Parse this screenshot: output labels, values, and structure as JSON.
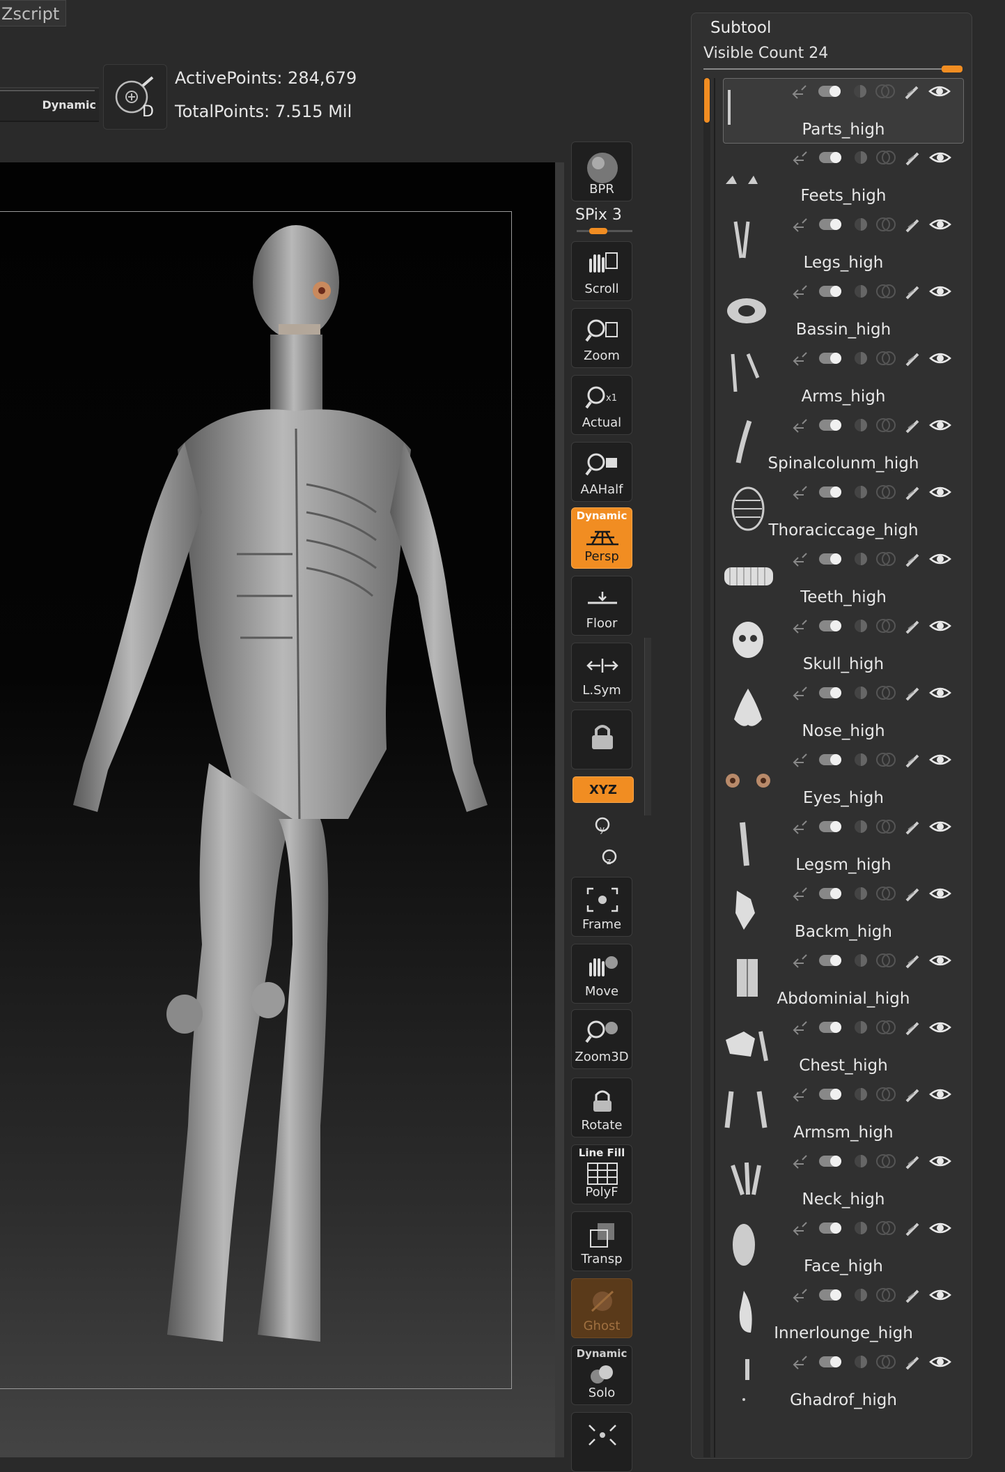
{
  "menu": {
    "zscript": "Zscript"
  },
  "top": {
    "dynamic_label": "Dynamic",
    "active_points": "ActivePoints: 284,679",
    "total_points": "TotalPoints: 7.515 Mil"
  },
  "shelf": {
    "bpr": "BPR",
    "spix_label": "SPix",
    "spix_value": "3",
    "scroll": "Scroll",
    "zoom": "Zoom",
    "actual": "Actual",
    "aahalf": "AAHalf",
    "persp_top": "Dynamic",
    "persp": "Persp",
    "floor": "Floor",
    "lsym": "L.Sym",
    "xyz": "XYZ",
    "frame": "Frame",
    "move": "Move",
    "zoom3d": "Zoom3D",
    "rotate": "Rotate",
    "polyf_top": "Line Fill",
    "polyf": "PolyF",
    "transp": "Transp",
    "ghost": "Ghost",
    "solo_top": "Dynamic",
    "solo": "Solo",
    "xpose": "Xpose"
  },
  "subtool": {
    "title": "Subtool",
    "visible_count_label": "Visible Count",
    "visible_count": "24",
    "items": [
      {
        "name": "Parts_high",
        "selected": true
      },
      {
        "name": "Feets_high"
      },
      {
        "name": "Legs_high"
      },
      {
        "name": "Bassin_high"
      },
      {
        "name": "Arms_high"
      },
      {
        "name": "Spinalcolunm_high"
      },
      {
        "name": "Thoraciccage_high"
      },
      {
        "name": "Teeth_high"
      },
      {
        "name": "Skull_high"
      },
      {
        "name": "Nose_high"
      },
      {
        "name": "Eyes_high"
      },
      {
        "name": "Legsm_high"
      },
      {
        "name": "Backm_high"
      },
      {
        "name": "Abdominial_high"
      },
      {
        "name": "Chest_high"
      },
      {
        "name": "Armsm_high"
      },
      {
        "name": "Neck_high"
      },
      {
        "name": "Face_high"
      },
      {
        "name": "Innerlounge_high"
      },
      {
        "name": "Ghadrof_high"
      }
    ]
  },
  "colors": {
    "accent": "#f18d22",
    "panel": "#303030",
    "background": "#2a2a2a"
  }
}
